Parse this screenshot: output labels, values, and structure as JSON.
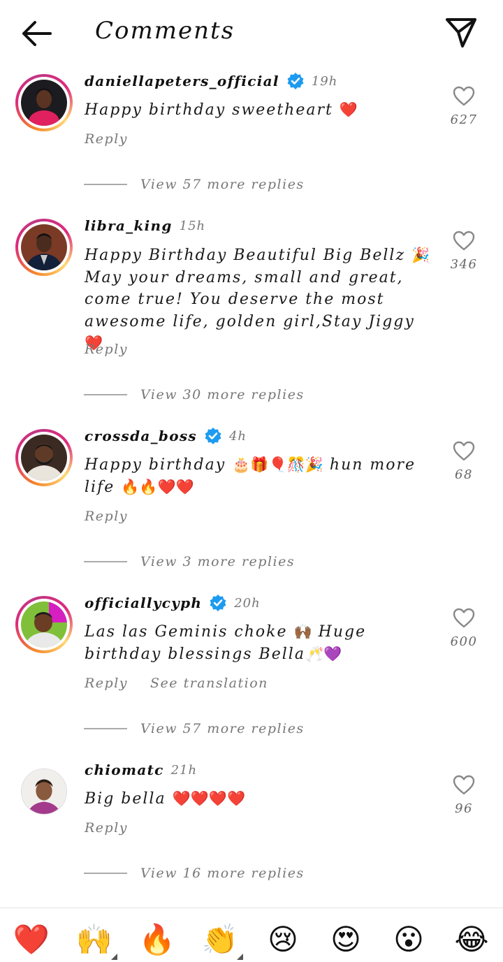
{
  "header": {
    "title": "Comments",
    "back_icon": "arrow-left-icon",
    "send_icon": "paper-plane-icon"
  },
  "colors": {
    "verified": "#1d9bf0",
    "heart_red": "#e0182d",
    "muted_text": "#777777"
  },
  "comments": [
    {
      "username": "daniellapeters_official",
      "verified": true,
      "time": "19h",
      "text": "Happy birthday sweetheart ",
      "emoji": "❤️",
      "likes": "627",
      "reply_label": "Reply",
      "view_replies": "View 57 more replies"
    },
    {
      "username": "libra_king",
      "verified": false,
      "time": "15h",
      "text_parts": [
        "Happy Birthday Beautiful Big Bellz ",
        "🎉",
        "May your dreams, small and great, come true! You deserve the most awesome life, golden girl,Stay Jiggy ",
        "❤️"
      ],
      "likes": "346",
      "reply_label": "Reply",
      "view_replies": "View 30 more replies"
    },
    {
      "username": "crossda_boss",
      "verified": true,
      "time": "4h",
      "text_parts": [
        "Happy birthday ",
        "🎂🎁🎈🎊🎉",
        " hun more life ",
        "🔥🔥❤️❤️"
      ],
      "likes": "68",
      "reply_label": "Reply",
      "view_replies": "View 3 more replies"
    },
    {
      "username": "officiallycyph",
      "verified": true,
      "time": "20h",
      "text_parts": [
        "Las las Geminis choke ",
        "🙌🏾",
        " Huge birthday blessings Bella",
        "🥂💜"
      ],
      "likes": "600",
      "reply_label": "Reply",
      "translation_label": "See translation",
      "view_replies": "View 57 more replies"
    },
    {
      "username": "chiomatc",
      "verified": false,
      "time": "21h",
      "text": "Big bella ",
      "emoji": "❤️❤️❤️❤️",
      "likes": "96",
      "reply_label": "Reply",
      "view_replies": "View 16 more replies"
    }
  ],
  "emoji_bar": [
    "❤️",
    "🙌",
    "🔥",
    "👏",
    "😢",
    "😍",
    "😮",
    "😂"
  ]
}
